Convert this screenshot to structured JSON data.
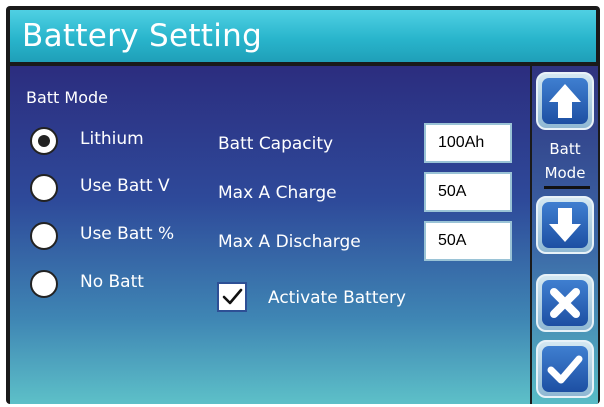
{
  "title": "Battery Setting",
  "batt_mode": {
    "heading": "Batt Mode",
    "options": [
      {
        "label": "Lithium",
        "selected": true
      },
      {
        "label": "Use Batt V",
        "selected": false
      },
      {
        "label": "Use Batt %",
        "selected": false
      },
      {
        "label": "No Batt",
        "selected": false
      }
    ]
  },
  "fields": {
    "capacity": {
      "label": "Batt Capacity",
      "value": "100Ah"
    },
    "max_charge": {
      "label": "Max A Charge",
      "value": "50A"
    },
    "max_discharge": {
      "label": "Max A Discharge",
      "value": "50A"
    }
  },
  "activate": {
    "label": "Activate Battery",
    "checked": true
  },
  "side": {
    "mode_label_line1": "Batt",
    "mode_label_line2": "Mode",
    "up_icon": "arrow-up-icon",
    "down_icon": "arrow-down-icon",
    "cancel_icon": "close-icon",
    "confirm_icon": "checkmark-icon"
  },
  "colors": {
    "title_bar": "#29b5cc",
    "panel_top": "#2c2d7f",
    "panel_bottom": "#5dc0c8",
    "button_blue": "#1d4fa3"
  }
}
